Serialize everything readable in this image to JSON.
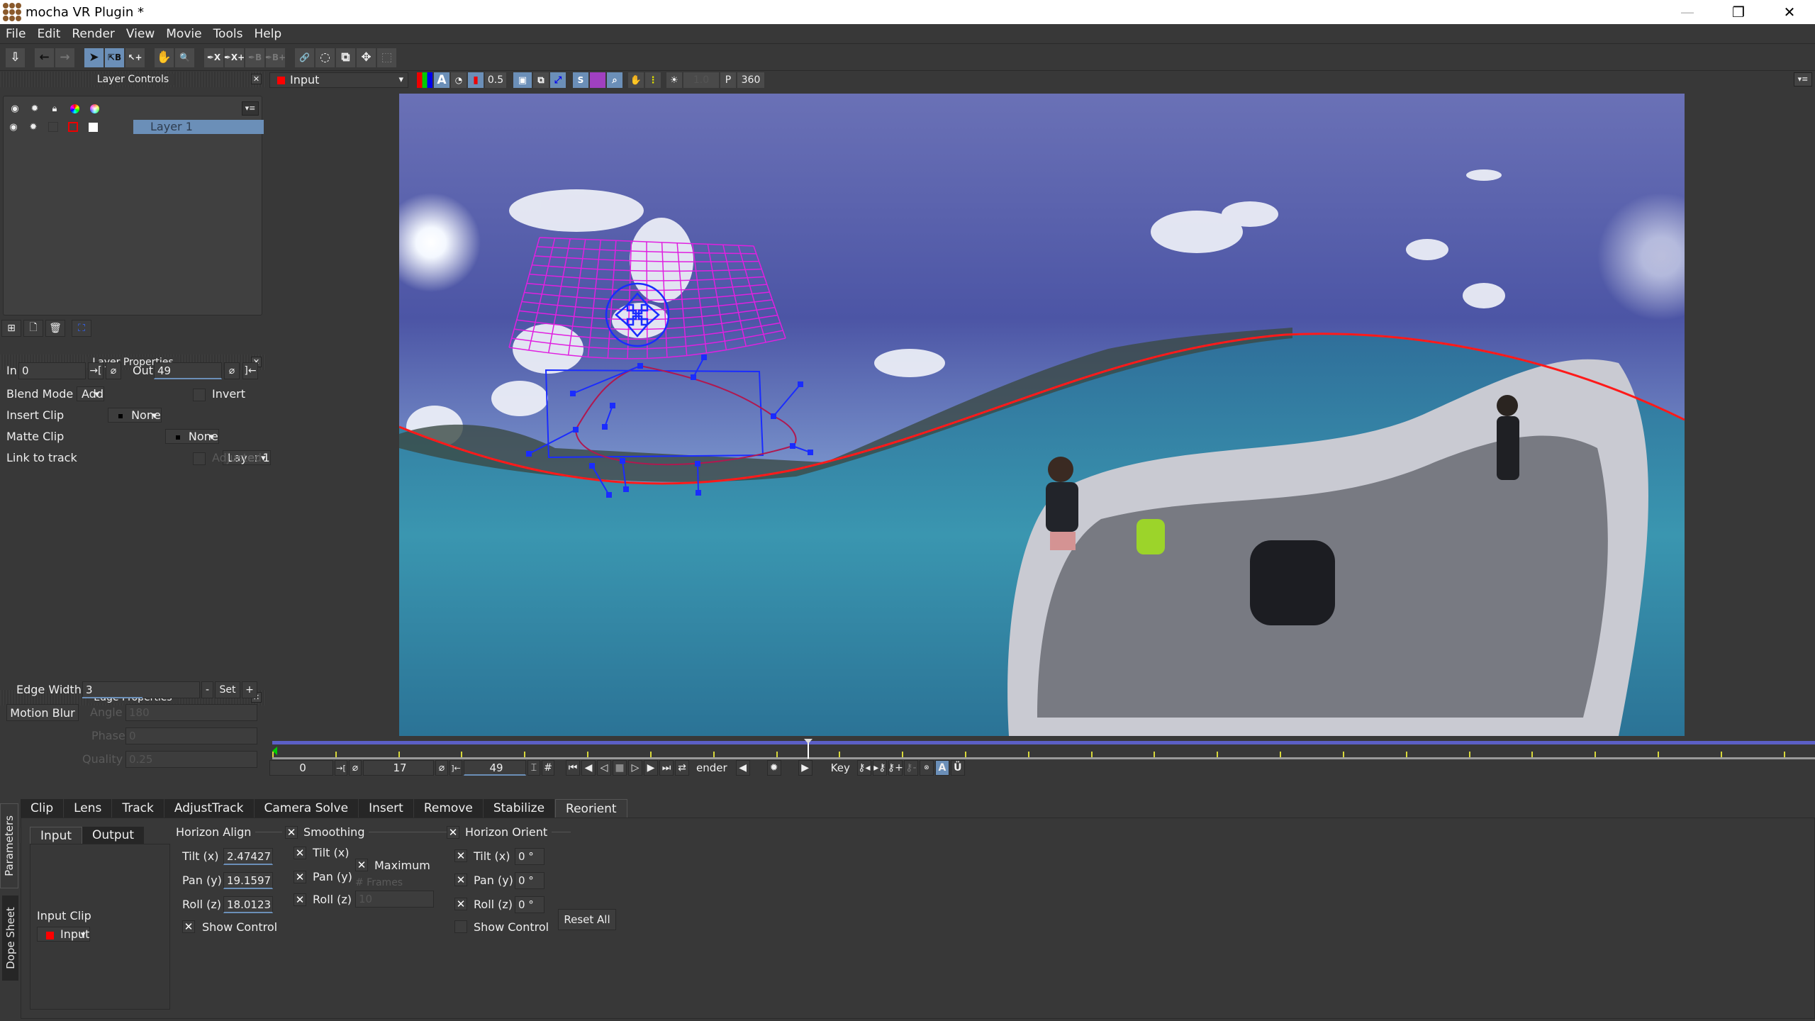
{
  "window": {
    "title": "mocha VR Plugin *",
    "minimize": "—",
    "restore": "❐",
    "close": "✕"
  },
  "menu": [
    "File",
    "Edit",
    "Render",
    "View",
    "Movie",
    "Tools",
    "Help"
  ],
  "toolbar": {
    "icons": [
      {
        "name": "save-icon",
        "glyph": "⇩",
        "state": "wht"
      },
      {
        "sep": true
      },
      {
        "name": "undo-arrow-icon",
        "glyph": "←",
        "state": ""
      },
      {
        "name": "redo-arrow-icon",
        "glyph": "→",
        "state": "dim"
      },
      {
        "sep": true
      },
      {
        "name": "select-tool-icon",
        "glyph": "➤",
        "state": "on"
      },
      {
        "name": "select-b-tool-icon",
        "glyph": "⇱B",
        "state": "on"
      },
      {
        "name": "select-add-tool-icon",
        "glyph": "↖+",
        "state": "wht"
      },
      {
        "sep": true
      },
      {
        "name": "pan-hand-icon",
        "glyph": "✋",
        "state": "wht"
      },
      {
        "name": "zoom-magnifier-icon",
        "glyph": "🔍",
        "state": "wht"
      },
      {
        "sep": true
      },
      {
        "name": "pen-x-spline-icon",
        "glyph": "✒X",
        "state": "wht"
      },
      {
        "name": "pen-x-add-icon",
        "glyph": "✒X+",
        "state": "wht"
      },
      {
        "name": "pen-b-spline-icon",
        "glyph": "✒B",
        "state": "dim"
      },
      {
        "name": "pen-b-add-icon",
        "glyph": "✒B+",
        "state": "dim"
      },
      {
        "sep": true
      },
      {
        "name": "link-icon",
        "glyph": "🔗",
        "state": "wht"
      },
      {
        "name": "rotate-lasso-icon",
        "glyph": "◌",
        "state": "wht"
      },
      {
        "name": "scale-icon",
        "glyph": "⧉",
        "state": "wht"
      },
      {
        "name": "move-icon",
        "glyph": "✥",
        "state": "wht"
      },
      {
        "name": "marquee-select-icon",
        "glyph": "⬚",
        "state": "dim"
      }
    ]
  },
  "layer_controls": {
    "title": "Layer Controls",
    "header_icons": [
      "eye-icon",
      "gear-icon",
      "lock-icon",
      "color-wheel-icon",
      "color-picker-icon"
    ],
    "layers": [
      {
        "name": "Layer 1",
        "selected": true
      }
    ],
    "footer_icons": [
      "new-group-icon",
      "new-layer-icon",
      "delete-icon",
      "fit-icon"
    ]
  },
  "layer_properties": {
    "title": "Layer Properties",
    "in_label": "In",
    "in_value": "0",
    "out_label": "Out",
    "out_value": "49",
    "blend_mode_label": "Blend Mode",
    "blend_mode": "Add",
    "invert_label": "Invert",
    "insert_clip_label": "Insert Clip",
    "insert_clip": "None",
    "matte_clip_label": "Matte Clip",
    "matte_clip": "None",
    "link_label": "Link to track",
    "link_value": "Layer 1",
    "adjusted_label": "Adjusted"
  },
  "edge_properties": {
    "title": "Edge Properties",
    "edge_width_label": "Edge Width",
    "edge_width": "3",
    "minus": "-",
    "set": "Set",
    "plus": "+",
    "motion_blur": "Motion Blur",
    "angle_label": "Angle",
    "angle": "180",
    "phase_label": "Phase",
    "phase": "0",
    "quality_label": "Quality",
    "quality": "0.25"
  },
  "viewer_bar": {
    "clip": "Input",
    "clip_color": "#ff0000",
    "opacity": "0.5",
    "exposure": "1.0",
    "p_label": "P",
    "mode": "360"
  },
  "timeline": {
    "start": "0",
    "current": "17",
    "end": "49",
    "render_label": "ender",
    "key_label": "Key",
    "playhead_frame": 17,
    "total_frames": 49
  },
  "parameters": {
    "title": "Parameters",
    "side_tabs": [
      "Parameters",
      "Dope Sheet"
    ],
    "tabs": [
      "Clip",
      "Lens",
      "Track",
      "AdjustTrack",
      "Camera Solve",
      "Insert",
      "Remove",
      "Stabilize",
      "Reorient"
    ],
    "active_tab": "Reorient",
    "io_tabs": [
      "Input",
      "Output"
    ],
    "input_clip_label": "Input Clip",
    "input_clip": "Input",
    "horizon_align": {
      "title": "Horizon Align",
      "tilt_label": "Tilt (x)",
      "tilt": "2.47427",
      "pan_label": "Pan (y)",
      "pan": "19.1597",
      "roll_label": "Roll (z)",
      "roll": "18.0123",
      "show_control": "Show Control",
      "show_control_checked": true
    },
    "smoothing": {
      "title": "Smoothing",
      "checked": true,
      "tilt": "Tilt (x)",
      "pan": "Pan (y)",
      "roll": "Roll (z)",
      "maximum": "Maximum S",
      "frames_label": "# Frames",
      "frames": "10"
    },
    "horizon_orient": {
      "title": "Horizon Orient",
      "checked": true,
      "tilt_label": "Tilt (x)",
      "tilt": "0 °",
      "pan_label": "Pan (y)",
      "pan": "0 °",
      "roll_label": "Roll (z)",
      "roll": "0 °",
      "show_control": "Show Control",
      "show_control_checked": false
    },
    "reset_all": "Reset All"
  },
  "colors": {
    "accent": "#6b8fb8",
    "spline_red": "#ff1a1a",
    "grid_magenta": "#e020e0",
    "handle_blue": "#1a2cff",
    "timeline_bar": "#5b5fc7"
  }
}
